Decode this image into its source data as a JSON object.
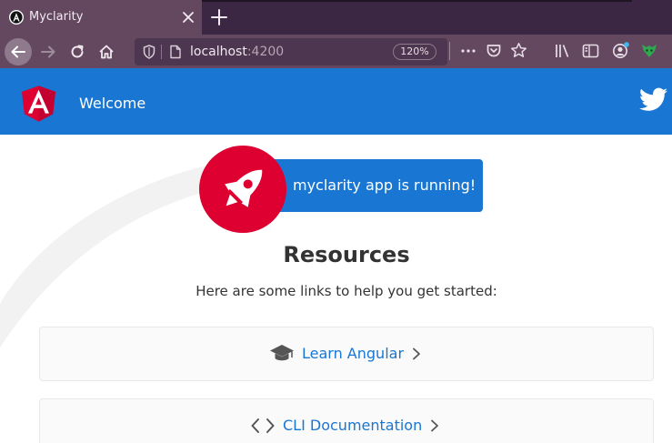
{
  "browser": {
    "tab": {
      "title": "Myclarity",
      "favicon": "angular-favicon"
    },
    "new_tab_icon": "plus-icon",
    "url": {
      "host": "localhost",
      "port": ":4200"
    },
    "zoom": "120%",
    "nav_icons": [
      "back-arrow-icon",
      "forward-arrow-icon",
      "reload-icon",
      "home-icon"
    ],
    "right_icons": [
      "more-icon",
      "pocket-icon",
      "star-icon",
      "library-icon",
      "sidebar-icon",
      "account-icon",
      "extension-icon"
    ]
  },
  "toolbar": {
    "title": "Welcome",
    "logo": "angular-logo",
    "social_icon": "twitter-icon",
    "color": "#1976d2"
  },
  "banner": {
    "text": "myclarity app is running!",
    "icon": "rocket-icon",
    "circle_color": "#dd0031"
  },
  "resources": {
    "title": "Resources",
    "subtitle": "Here are some links to help you get started:",
    "cards": [
      {
        "label": "Learn Angular",
        "icon": "graduation-cap-icon"
      },
      {
        "label": "CLI Documentation",
        "icon": "code-icon"
      }
    ]
  }
}
